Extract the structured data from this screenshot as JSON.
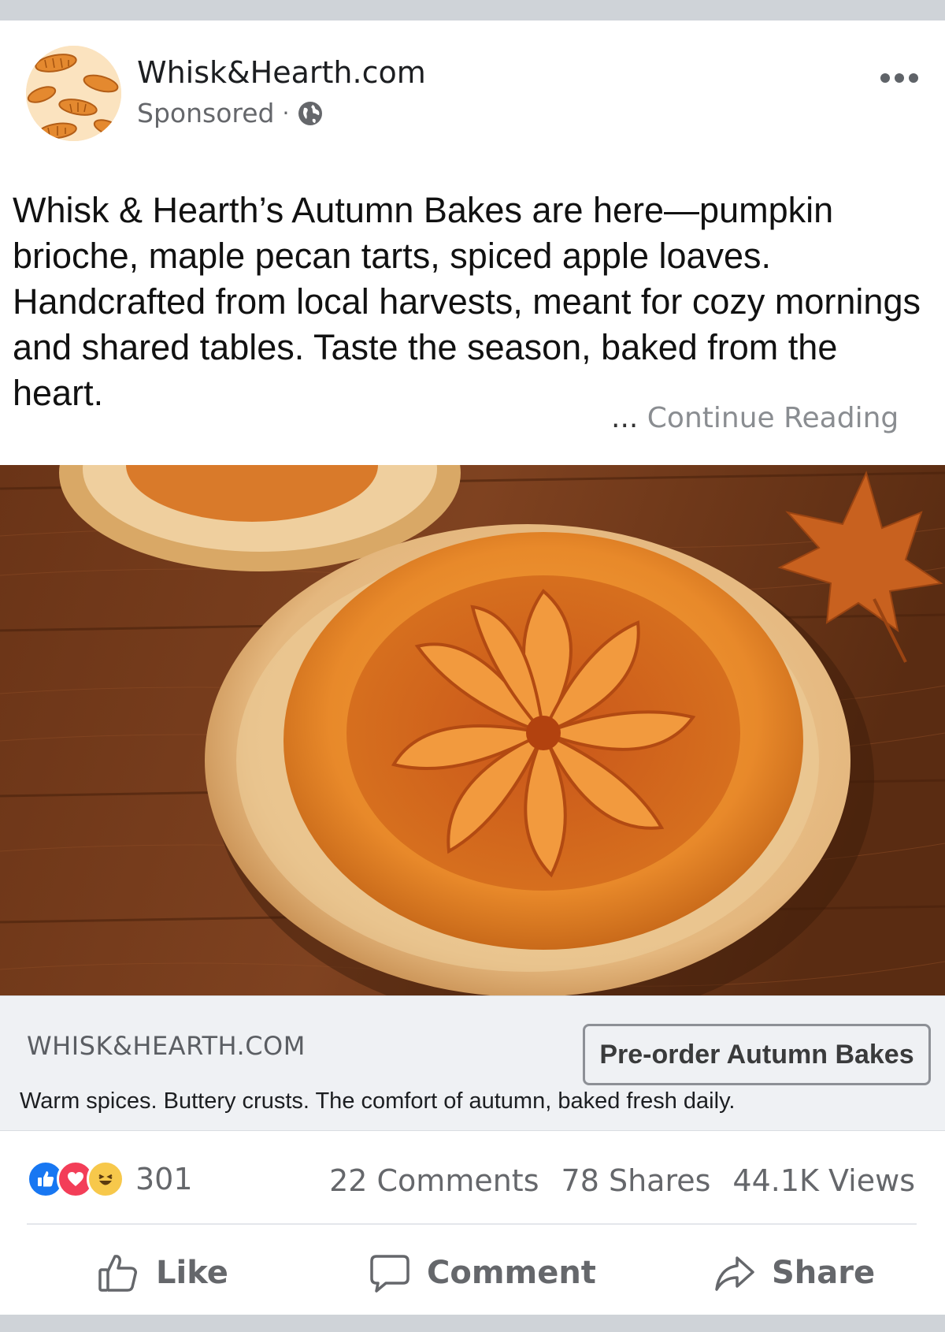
{
  "post": {
    "page_name": "Whisk&Hearth.com",
    "sponsored_label": "Sponsored",
    "separator": "·",
    "caption": "Whisk & Hearth’s Autumn Bakes are here—pumpkin brioche, maple pecan tarts, spiced apple loaves. Handcrafted from local harvests, meant for cozy mornings and shared tables. Taste the season, baked from the heart.",
    "continue_ellipsis": "...",
    "continue_label": "Continue Reading"
  },
  "link_preview": {
    "domain": "WHISK&HEARTH.COM",
    "cta_label": "Pre-order Autumn Bakes",
    "description": "Warm spices. Buttery crusts. The comfort of autumn, baked fresh daily."
  },
  "stats": {
    "reaction_count": "301",
    "comments": "22 Comments",
    "shares": "78 Shares",
    "views": "44.1K Views"
  },
  "actions": {
    "like": "Like",
    "comment": "Comment",
    "share": "Share"
  },
  "icons": {
    "more": "more-horizontal-icon",
    "audience": "globe-icon",
    "reactions": [
      "like-reaction-icon",
      "love-reaction-icon",
      "haha-reaction-icon"
    ],
    "like": "thumbs-up-icon",
    "comment": "speech-bubble-icon",
    "share": "share-arrow-icon"
  },
  "colors": {
    "brand_blue": "#1877f2",
    "love_red": "#f33e58",
    "haha_yellow": "#f7c84b",
    "muted_text": "#65676b",
    "link_box_bg": "#eff1f4"
  }
}
